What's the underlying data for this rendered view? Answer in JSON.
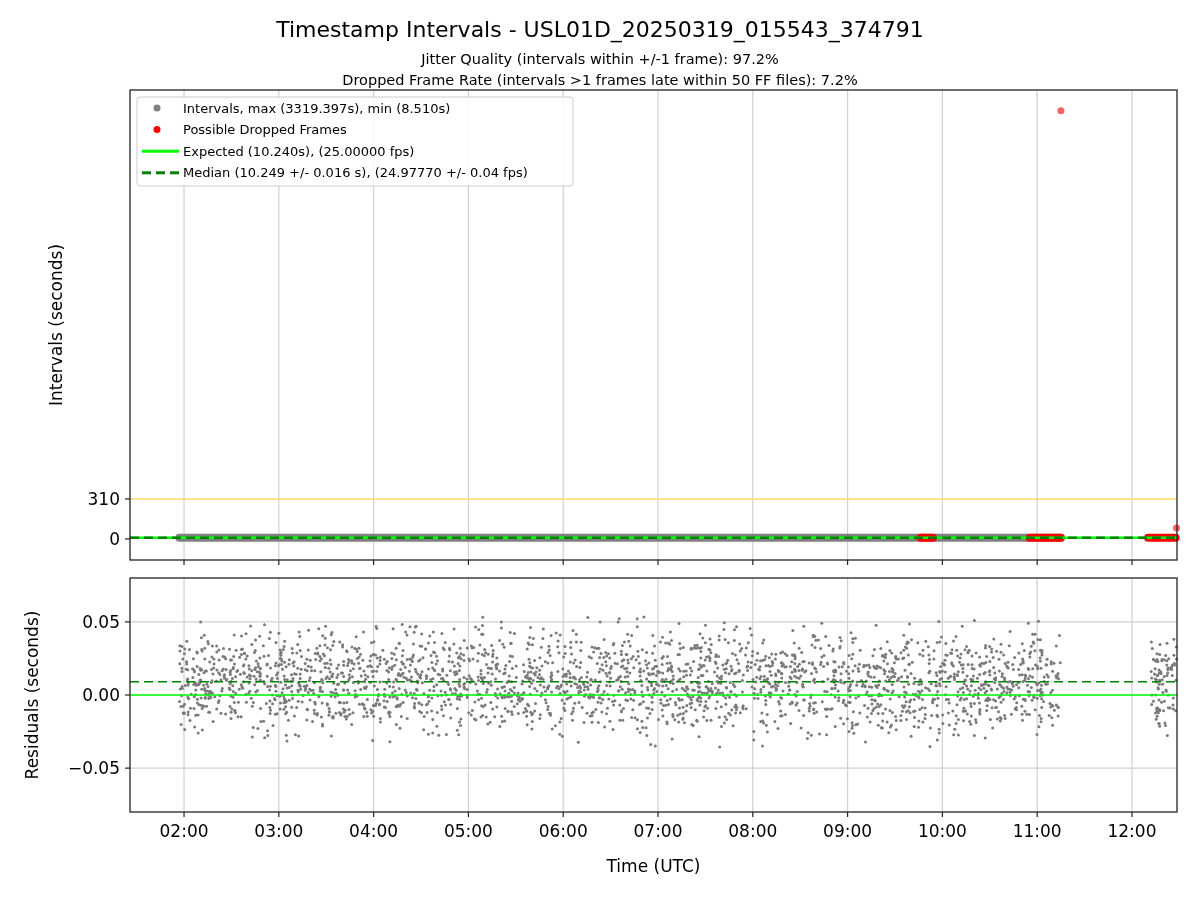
{
  "figure": {
    "title": "Timestamp Intervals - USL01D_20250319_015543_374791",
    "subtitles": [
      "Jitter Quality (intervals within +/-1 frame): 97.2%",
      "Dropped Frame Rate (intervals >1 frames late within 50 FF files): 7.2%"
    ]
  },
  "intervals_plot": {
    "legend_markers": [
      {
        "label": "Intervals, max (3319.397s), min (8.510s)",
        "color": "#808080"
      },
      {
        "label": "Possible Dropped Frames",
        "color": "#ff0000"
      }
    ],
    "chart_data": {
      "type": "line",
      "ylabel": "Intervals (seconds)",
      "x": [
        1.43,
        12.475
      ],
      "xlim": [
        1.43,
        12.475
      ],
      "ylim": [
        -163,
        3480
      ],
      "grid": true,
      "yticks": [
        {
          "value": 0,
          "label": "0"
        },
        {
          "value": 310,
          "label": "310"
        }
      ],
      "series": [
        {
          "color": "#ffd966",
          "line_style": "solid",
          "values": [
            310,
            310
          ]
        },
        {
          "name": "Expected (10.240s), (25.00000 fps)",
          "color": "#00ff00",
          "line_style": "solid",
          "values": [
            10,
            10
          ]
        },
        {
          "name": "Median (10.249 +/- 0.016 s), (24.97770 +/- 0.04 fps)",
          "color": "#008000",
          "line_style": "dashed",
          "values": [
            10,
            10
          ]
        }
      ]
    }
  },
  "residuals_plot": {
    "chart_data": {
      "type": "line",
      "xlabel": "Time (UTC)",
      "ylabel": "Residuals (seconds)",
      "x": [
        1.43,
        12.475
      ],
      "xlim": [
        1.43,
        12.475
      ],
      "ylim": [
        -0.08,
        0.08
      ],
      "grid": true,
      "yticks": [
        {
          "value": 0.05,
          "label": "0.05"
        },
        {
          "value": 0,
          "label": "0.00"
        },
        {
          "value": -0.05,
          "label": "−0.05"
        }
      ],
      "xticks": [
        {
          "value": 2,
          "label": "02:00"
        },
        {
          "value": 3,
          "label": "03:00"
        },
        {
          "value": 4,
          "label": "04:00"
        },
        {
          "value": 5,
          "label": "05:00"
        },
        {
          "value": 6,
          "label": "06:00"
        },
        {
          "value": 7,
          "label": "07:00"
        },
        {
          "value": 8,
          "label": "08:00"
        },
        {
          "value": 9,
          "label": "09:00"
        },
        {
          "value": 10,
          "label": "10:00"
        },
        {
          "value": 11,
          "label": "11:00"
        },
        {
          "value": 12,
          "label": "12:00"
        }
      ],
      "series": [
        {
          "color": "#00ff00",
          "line_style": "solid",
          "values": [
            0,
            0
          ]
        },
        {
          "color": "#008000",
          "line_style": "dashed",
          "values": [
            0.009,
            0.009
          ]
        }
      ]
    }
  }
}
